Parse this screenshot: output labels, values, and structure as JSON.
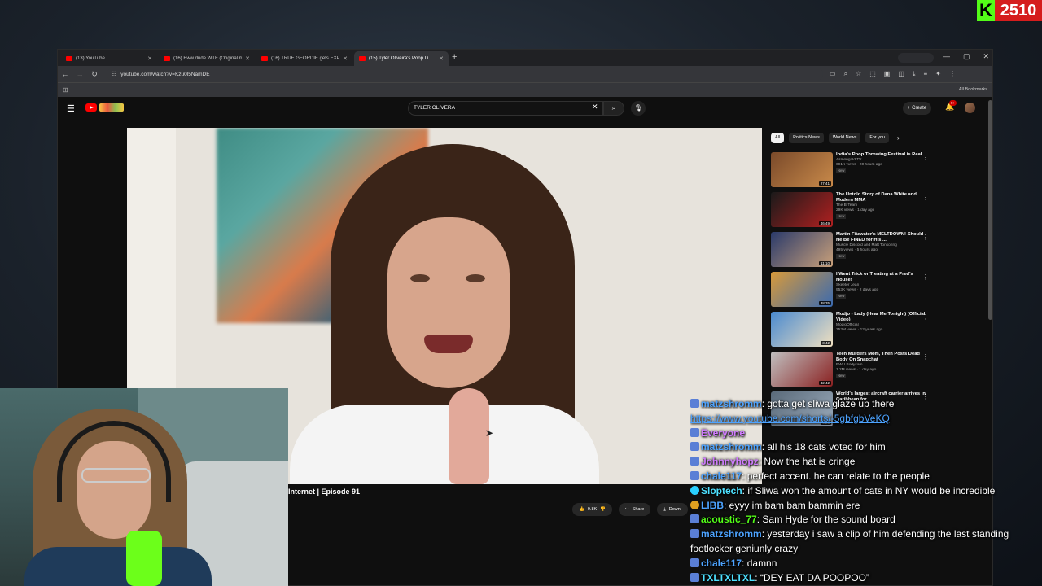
{
  "kick": {
    "logo_letter": "K",
    "viewer_count": "2510"
  },
  "browser": {
    "tabs": [
      {
        "label": "(13) YouTube"
      },
      {
        "label": "(16) Eww dude WTF (Original m"
      },
      {
        "label": "(16) TRUE GEORDIE gets EXPO"
      },
      {
        "label": "(15) Tyler Oliveira's Poop D"
      }
    ],
    "url": "youtube.com/watch?v=Kzu0l5NamDE",
    "bookmarks_label": "All Bookmarks"
  },
  "youtube": {
    "search_query": "TYLER OLIVERA",
    "create_label": "Create",
    "notification_count": "9+",
    "video_title_partial": "Internet | Episode 91",
    "like_count": "9.8K",
    "share_label": "Share",
    "download_label": "Downl",
    "chips": [
      "All",
      "Politics News",
      "World News",
      "For you"
    ],
    "recommendations": [
      {
        "title": "India's Poop Throwing Festival is Real",
        "channel": "Asmongold TV",
        "stats": "691K views · 20 hours ago",
        "badge": "New",
        "duration": "27:41",
        "colors": [
          "#7a4a2a",
          "#c98a4a"
        ]
      },
      {
        "title": "The Untold Story of Dana White and Modern MMA",
        "channel": "The B-Team",
        "stats": "29K views · 1 day ago",
        "badge": "New",
        "duration": "46:49",
        "colors": [
          "#1a1a1a",
          "#b02020"
        ]
      },
      {
        "title": "Martin Fitzwater's MELTDOWN! Should He Be FINED for His ...",
        "channel": "Muscle Discord and Matt Tonkoring",
        "stats": "495 views · 5 hours ago",
        "badge": "New",
        "duration": "11:10",
        "colors": [
          "#2a3a6a",
          "#c9a07a"
        ]
      },
      {
        "title": "I Went Trick or Treating at a Pred's House!",
        "channel": "Skeeter Jean",
        "stats": "953K views · 2 days ago",
        "badge": "New",
        "duration": "38:35",
        "colors": [
          "#d89a3a",
          "#3a6ab0"
        ]
      },
      {
        "title": "Modjo - Lady (Hear Me Tonight) (Official Video)",
        "channel": "ModjoOfficial",
        "stats": "353M views · 12 years ago",
        "badge": "",
        "duration": "3:42",
        "colors": [
          "#4a8ad0",
          "#f0e0c0"
        ]
      },
      {
        "title": "Teen Murders Mom, Then Posts Dead Body On Snapchat",
        "channel": "EWU Bodycam",
        "stats": "1.2M views · 1 day ago",
        "badge": "New",
        "duration": "42:42",
        "colors": [
          "#c0c0c0",
          "#8a2020"
        ]
      },
      {
        "title": "World's largest aircraft carrier arrives in Caribbean for ...",
        "channel": "",
        "stats": "",
        "badge": "",
        "duration": "4:23",
        "colors": [
          "#5a6a7a",
          "#9aaaba"
        ]
      }
    ]
  },
  "chat": {
    "messages": [
      {
        "user": "matzshromm",
        "text": ": gotta get sliwa glaze up there ",
        "link": "https://www.youtube.com/shorts/-5gbfgbVeKQ",
        "color": "#4da3ff",
        "badge": "b1"
      },
      {
        "user": "Everyone",
        "text": "",
        "link": "",
        "color": "#d07bff",
        "badge": "b1"
      },
      {
        "user": "matzshromm",
        "text": ": all his 18 cats voted for him",
        "link": "",
        "color": "#4da3ff",
        "badge": "b1"
      },
      {
        "user": "Johnnyhopz",
        "text": ": Now the hat is cringe",
        "link": "",
        "color": "#d07bff",
        "badge": "b1"
      },
      {
        "user": "chale117",
        "text": ": perfect accent. he can relate to the people",
        "link": "",
        "color": "#4da3ff",
        "badge": "b1"
      },
      {
        "user": "Sloptech",
        "text": ": if Sliwa won the amount of cats in NY would be incredible",
        "link": "",
        "color": "#4de0ff",
        "badge": "b2"
      },
      {
        "user": "LIBB",
        "text": ": eyyy im bam bam bammin ere",
        "link": "",
        "color": "#4da3ff",
        "badge": "b3"
      },
      {
        "user": "acoustic_77",
        "text": ": Sam Hyde for the sound board",
        "link": "",
        "color": "#53fc18",
        "badge": "b1"
      },
      {
        "user": "matzshromm",
        "text": ": yesterday i saw a clip of him defending the last standing footlocker geniunly crazy",
        "link": "",
        "color": "#4da3ff",
        "badge": "b1"
      },
      {
        "user": "chale117",
        "text": ": damnn",
        "link": "",
        "color": "#4da3ff",
        "badge": "b1"
      },
      {
        "user": "TXLTXLTXL",
        "text": ": “DEY EAT DA POOPOO”",
        "link": "",
        "color": "#4de0ff",
        "badge": "b1"
      }
    ]
  }
}
